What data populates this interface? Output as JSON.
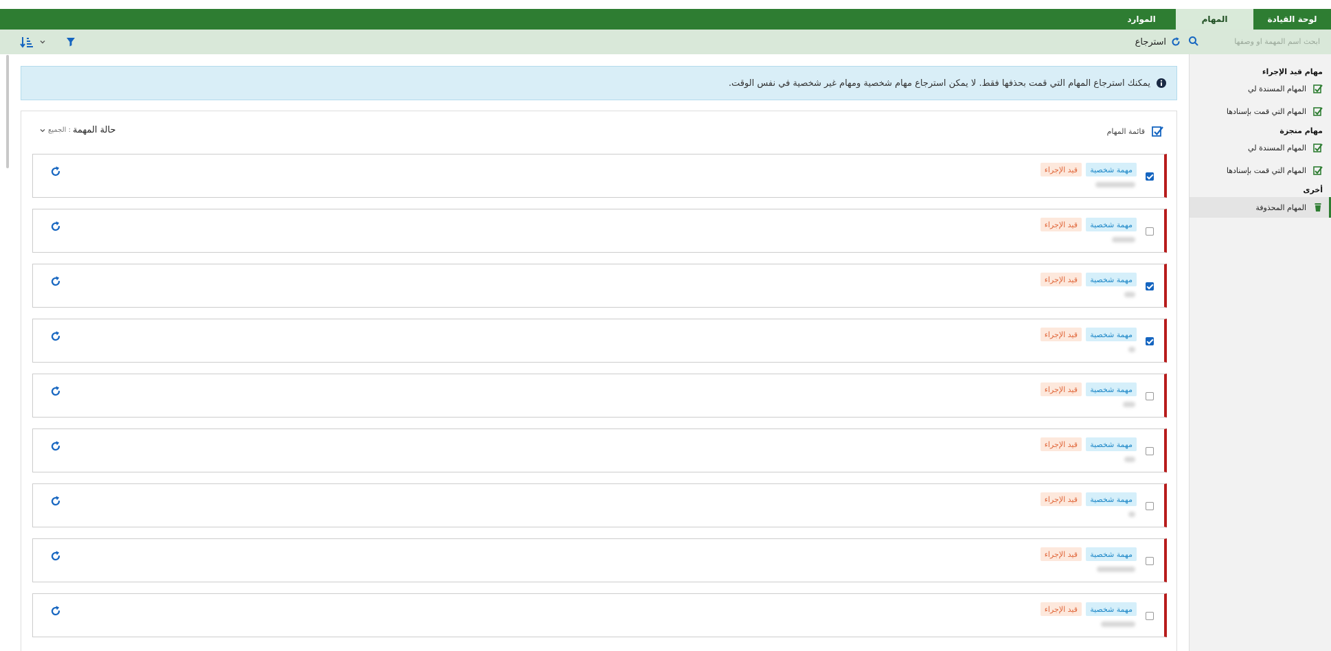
{
  "nav": {
    "tabs": [
      {
        "label": "لوحة القيادة"
      },
      {
        "label": "المهام"
      },
      {
        "label": "الموارد"
      }
    ]
  },
  "toolbar": {
    "search_placeholder": "ابحث اسم المهمة او وصفها",
    "restore_label": "استرجاع"
  },
  "sidebar": {
    "sections": [
      {
        "title": "مهام قيد الإجراء",
        "items": [
          "المهام المسندة لي",
          "المهام التي قمت بإسنادها"
        ]
      },
      {
        "title": "مهام منجزة",
        "items": [
          "المهام المسندة لي",
          "المهام التي قمت بإسنادها"
        ]
      },
      {
        "title": "أخرى",
        "items": [
          "المهام المحذوفة"
        ]
      }
    ]
  },
  "info": {
    "message": "يمكنك استرجاع المهام التي قمت بحذفها فقط. لا يمكن استرجاع مهام شخصية ومهام غير شخصية في نفس الوقت."
  },
  "panel": {
    "title": "قائمة المهام",
    "filter_label": "حالة المهمة",
    "filter_value": ": الجميع"
  },
  "tasks": [
    {
      "type": "مهمة شخصية",
      "status": "قيد الإجراء",
      "checked": true
    },
    {
      "type": "مهمة شخصية",
      "status": "قيد الإجراء",
      "checked": false
    },
    {
      "type": "مهمة شخصية",
      "status": "قيد الإجراء",
      "checked": true
    },
    {
      "type": "مهمة شخصية",
      "status": "قيد الإجراء",
      "checked": true
    },
    {
      "type": "مهمة شخصية",
      "status": "قيد الإجراء",
      "checked": false
    },
    {
      "type": "مهمة شخصية",
      "status": "قيد الإجراء",
      "checked": false
    },
    {
      "type": "مهمة شخصية",
      "status": "قيد الإجراء",
      "checked": false
    },
    {
      "type": "مهمة شخصية",
      "status": "قيد الإجراء",
      "checked": false
    },
    {
      "type": "مهمة شخصية",
      "status": "قيد الإجراء",
      "checked": false
    }
  ],
  "colors": {
    "primary_green": "#2e7d32",
    "toolbar_bg": "#d9e8d9",
    "accent_blue": "#1565c0",
    "task_border": "#b71c1c"
  }
}
